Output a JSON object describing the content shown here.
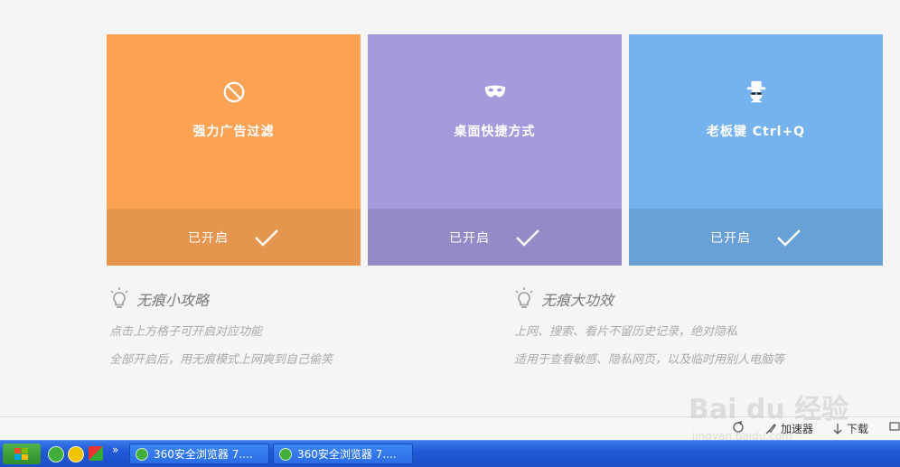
{
  "cards": [
    {
      "title": "强力广告过滤",
      "status": "已开启",
      "icon": "block-icon",
      "color_top": "#fba255",
      "color_bottom": "#e5954d"
    },
    {
      "title": "桌面快捷方式",
      "status": "已开启",
      "icon": "mask-icon",
      "color_top": "#a79adc",
      "color_bottom": "#968ac6"
    },
    {
      "title": "老板键 Ctrl+Q",
      "status": "已开启",
      "icon": "boss-icon",
      "color_top": "#75b2ee",
      "color_bottom": "#69a1d6"
    }
  ],
  "tips": {
    "left": {
      "title": "无痕小攻略",
      "lines": [
        "点击上方格子可开启对应功能",
        "全部开启后，用无痕模式上网爽到自己偷笑"
      ]
    },
    "right": {
      "title": "无痕大功效",
      "lines": [
        "上网、搜索、看片不留历史记录，绝对隐私",
        "适用于查看敏感、隐私网页，以及临时用别人电脑等"
      ]
    }
  },
  "statusbar": {
    "accelerator": "加速器",
    "download": "下载"
  },
  "taskbar": {
    "tasks": [
      "360安全浏览器 7....",
      "360安全浏览器 7...."
    ],
    "overflow": "»"
  },
  "watermark": {
    "text": "Bai du 经验",
    "sub": "jingyan.baidu.com"
  }
}
